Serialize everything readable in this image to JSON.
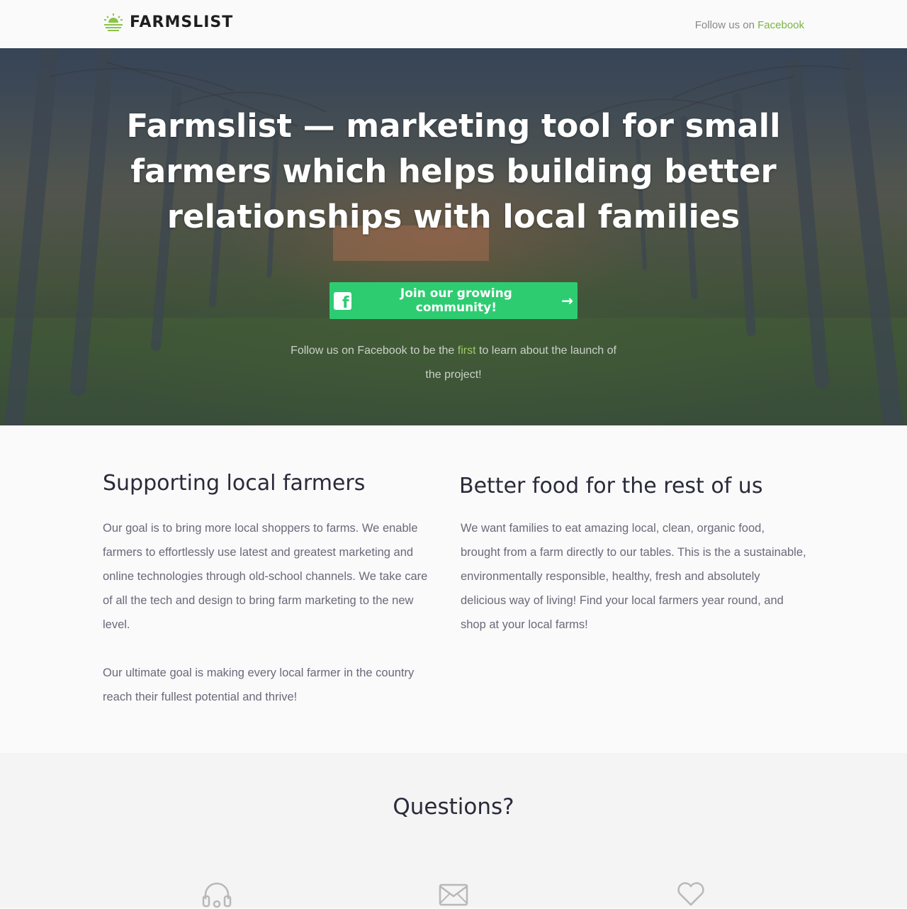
{
  "header": {
    "logo_text": "FARMSLIST",
    "follow_prefix": "Follow us on",
    "follow_link": "Facebook"
  },
  "hero": {
    "title": "Farmslist — marketing tool for small farmers which helps building better relationships with local families",
    "cta_label": "Join our growing community!",
    "sub_part1": "Follow us on Facebook to be the",
    "sub_first": "first",
    "sub_part2": "to learn about the launch of the project!"
  },
  "columns": {
    "left": {
      "heading": "Supporting local farmers",
      "paragraphs": [
        "Our goal is to bring more local shoppers to farms. We enable farmers to effortlessly use latest and greatest marketing and online technologies through old-school channels. We take care of all the tech and design to bring farm marketing to the new level.",
        "Our ultimate goal is making every local farmer in the country reach their fullest potential and thrive!"
      ]
    },
    "right": {
      "heading": "Better food for the rest of us",
      "paragraphs": [
        "We want families to eat amazing local, clean, organic food, brought from a farm directly to our tables. This is the a sustainable, environmentally responsible, healthy, fresh and absolutely delicious way of living! Find your local farmers year round, and shop at your local farms!"
      ]
    }
  },
  "questions": {
    "heading": "Questions?",
    "icons": [
      "headset-icon",
      "envelope-icon",
      "heart-icon"
    ]
  },
  "colors": {
    "accent_green": "#2ecc71",
    "link_green": "#7cb342",
    "text_gray": "#6a6a7a"
  }
}
